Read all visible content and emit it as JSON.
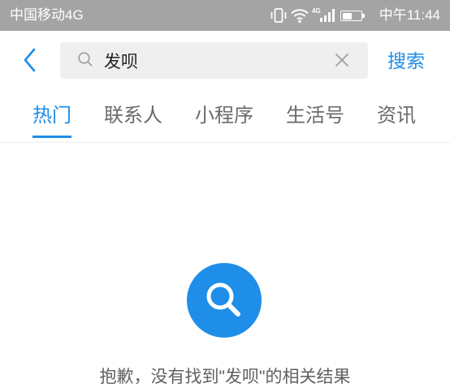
{
  "status_bar": {
    "carrier": "中国移动4G",
    "network_badge": "4G",
    "time": "中午11:44",
    "battery_level": 0.5,
    "icons": [
      "vibrate-icon",
      "wifi-icon",
      "signal-icon",
      "battery-icon"
    ]
  },
  "header": {
    "back_icon": "chevron-left-icon",
    "search": {
      "icon": "search-icon",
      "query": "发呗",
      "clear_icon": "close-icon"
    },
    "submit_label": "搜索"
  },
  "tabs": [
    {
      "label": "热门",
      "active": true
    },
    {
      "label": "联系人",
      "active": false
    },
    {
      "label": "小程序",
      "active": false
    },
    {
      "label": "生活号",
      "active": false
    },
    {
      "label": "资讯",
      "active": false
    }
  ],
  "empty_state": {
    "icon": "search-icon",
    "message": "抱歉，没有找到\"发呗\"的相关结果"
  },
  "theme": {
    "accent": "#1e8ee8",
    "status_bar_bg": "#a4a4a4"
  }
}
